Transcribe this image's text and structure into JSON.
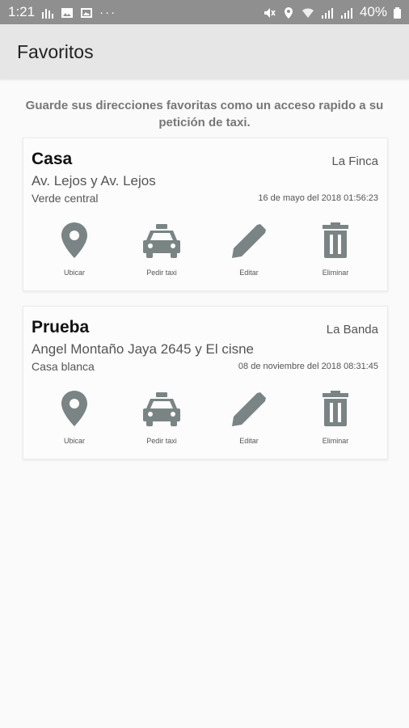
{
  "status_bar": {
    "time": "1:21",
    "dots": "···",
    "battery": "40%",
    "left_icons": [
      "chart-icon",
      "image-icon",
      "gallery-icon"
    ],
    "right_icons": [
      "mute-icon",
      "location-icon",
      "wifi-icon",
      "signal-icon",
      "signal-icon",
      "battery-icon"
    ]
  },
  "app_bar": {
    "title": "Favoritos"
  },
  "intro_text": "Guarde sus direcciones favoritas como un acceso rapido a su petición de taxi.",
  "favorites": [
    {
      "name": "Casa",
      "zone": "La Finca",
      "address": "Av. Lejos y Av. Lejos",
      "reference": "Verde central",
      "date": "16 de mayo del 2018 01:56:23",
      "actions": [
        {
          "label": "Ubicar",
          "icon": "location-pin-icon"
        },
        {
          "label": "Pedir taxi",
          "icon": "taxi-icon"
        },
        {
          "label": "Editar",
          "icon": "pencil-icon"
        },
        {
          "label": "Eliminar",
          "icon": "trash-icon"
        }
      ]
    },
    {
      "name": "Prueba",
      "zone": "La Banda",
      "address": "Angel Montaño Jaya 2645 y El cisne",
      "reference": "Casa blanca",
      "date": "08 de noviembre del 2018 08:31:45",
      "actions": [
        {
          "label": "Ubicar",
          "icon": "location-pin-icon"
        },
        {
          "label": "Pedir taxi",
          "icon": "taxi-icon"
        },
        {
          "label": "Editar",
          "icon": "pencil-icon"
        },
        {
          "label": "Eliminar",
          "icon": "trash-icon"
        }
      ]
    }
  ],
  "colors": {
    "status_bar": "#8f8f8f",
    "app_bar": "#e6e6e6",
    "icon": "#7a8484",
    "intro_text": "#777777"
  }
}
